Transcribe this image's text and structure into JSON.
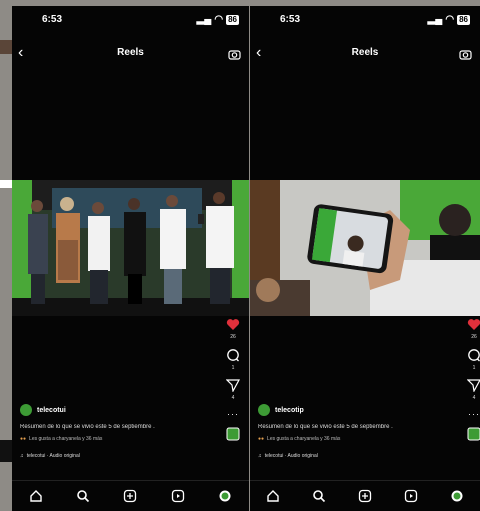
{
  "screens": [
    {
      "status_time": "6:53",
      "header_title": "Reels",
      "username": "telecotui",
      "caption": "Resumen de lo que se vivió este 5 de septiembre .",
      "liked_by": "Les gusta a charyanela y 36 más",
      "audio": "telecotui · Audio original",
      "likes": "26",
      "comments": "1",
      "shares": "4"
    },
    {
      "status_time": "6:53",
      "header_title": "Reels",
      "username": "telecotip",
      "caption": "Resumen de lo que se vivió este 5 de septiembre .",
      "liked_by": "Les gusta a charyanela y 36 más",
      "audio": "telecotui · Audio original",
      "likes": "26",
      "comments": "1",
      "shares": "4"
    }
  ],
  "colors": {
    "like_red": "#e0303b",
    "brand_green": "#3d9b35"
  },
  "nav_icons": [
    "home-icon",
    "search-icon",
    "create-icon",
    "reels-icon",
    "profile-icon"
  ]
}
